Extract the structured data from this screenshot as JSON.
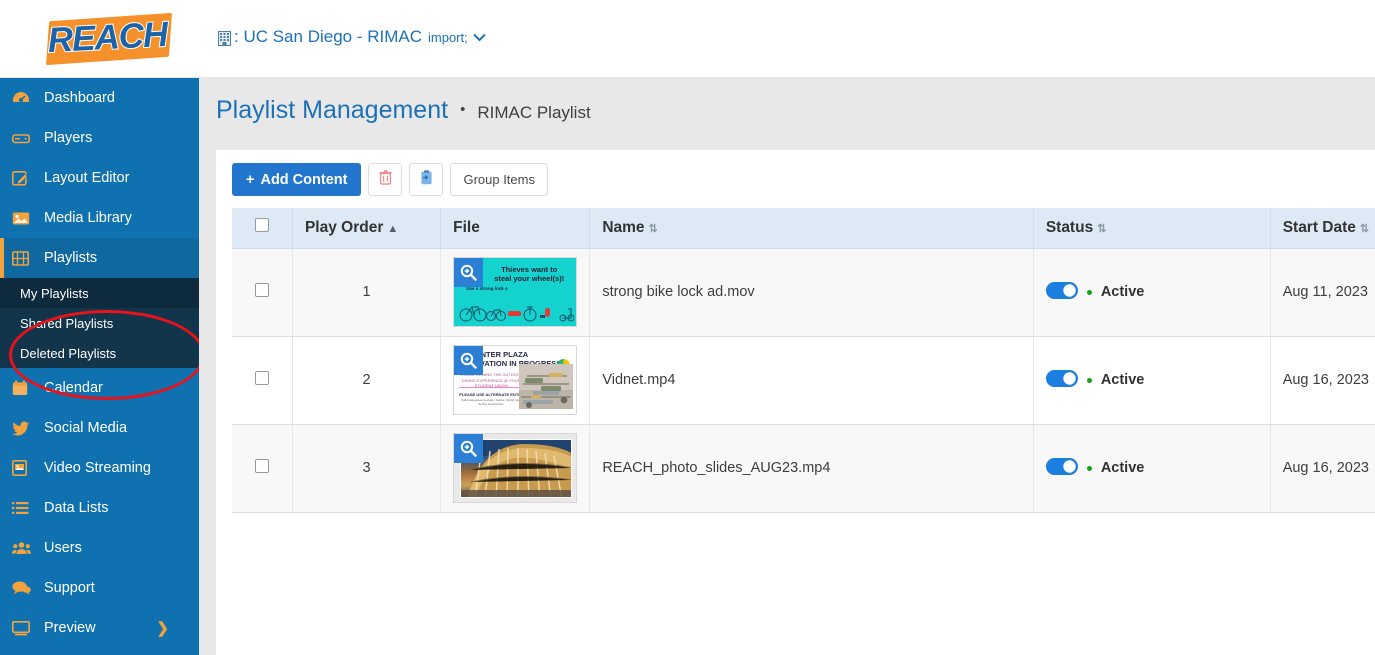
{
  "brand": {
    "logo_text": "REACH"
  },
  "header": {
    "site_icon": "building-icon",
    "site_label": ": UC San Diego - RIMAC",
    "caret": "chevron-down-icon"
  },
  "sidebar": {
    "items": [
      {
        "label": "Dashboard",
        "icon": "dashboard-icon"
      },
      {
        "label": "Players",
        "icon": "player-icon"
      },
      {
        "label": "Layout Editor",
        "icon": "edit-icon"
      },
      {
        "label": "Media Library",
        "icon": "image-icon"
      },
      {
        "label": "Playlists",
        "icon": "film-icon"
      },
      {
        "label": "Calendar",
        "icon": "calendar-icon"
      },
      {
        "label": "Social Media",
        "icon": "twitter-icon"
      },
      {
        "label": "Video Streaming",
        "icon": "video-icon"
      },
      {
        "label": "Data Lists",
        "icon": "list-icon"
      },
      {
        "label": "Users",
        "icon": "users-icon"
      },
      {
        "label": "Support",
        "icon": "chat-icon"
      },
      {
        "label": "Preview",
        "icon": "monitor-icon"
      }
    ],
    "submenu": [
      {
        "label": "My Playlists"
      },
      {
        "label": "Shared Playlists"
      },
      {
        "label": "Deleted Playlists"
      }
    ]
  },
  "page": {
    "title": "Playlist Management",
    "separator": "•",
    "subtitle": "RIMAC Playlist"
  },
  "toolbar": {
    "add_label": "Add Content",
    "add_plus": "+",
    "delete_icon": "trash-icon",
    "paste_icon": "clipboard-icon",
    "group_label": "Group Items"
  },
  "table": {
    "columns": [
      {
        "key": "check",
        "label": "",
        "sort": ""
      },
      {
        "key": "order",
        "label": "Play Order",
        "sort": "▲"
      },
      {
        "key": "file",
        "label": "File",
        "sort": ""
      },
      {
        "key": "name",
        "label": "Name",
        "sort": "⇅"
      },
      {
        "key": "status",
        "label": "Status",
        "sort": "⇅"
      },
      {
        "key": "date",
        "label": "Start Date",
        "sort": "⇅"
      }
    ],
    "rows": [
      {
        "order": "1",
        "name": "strong bike lock ad.mov",
        "status": "Active",
        "date": "Aug 11, 2023",
        "thumb": {
          "kind": "bike-ad",
          "line1": "Thieves want to",
          "line2": "steal your wheel(s)!",
          "line3": "Use a strong lock o"
        }
      },
      {
        "order": "2",
        "name": "Vidnet.mp4",
        "status": "Active",
        "date": "Aug 16, 2023",
        "thumb": {
          "kind": "plaza",
          "line1": "CENTER PLAZA",
          "line2": "RENOVATION IN PROGRESS",
          "line3": "TRANSFORMING THE OUTDOOR DINING EXPERIENCE @ YOUR STUDENT UNION",
          "line4": "PLEASE USE ALTERNATE ENTRANCES.",
          "line5": "THE businesses (except l Jambe, Subs) open during construction"
        }
      },
      {
        "order": "3",
        "name": "REACH_photo_slides_AUG23.mp4",
        "status": "Active",
        "date": "Aug 16, 2023",
        "thumb": {
          "kind": "building-photo"
        }
      }
    ]
  },
  "colors": {
    "sidebar": "#1071b0",
    "submenu": "#12354b",
    "accent_orange": "#f0a23c",
    "primary_blue": "#2276cd",
    "title_blue": "#1c71b8",
    "header_row": "#ddeaf6",
    "status_green": "#17a317",
    "annotation_red": "#e8131a"
  }
}
